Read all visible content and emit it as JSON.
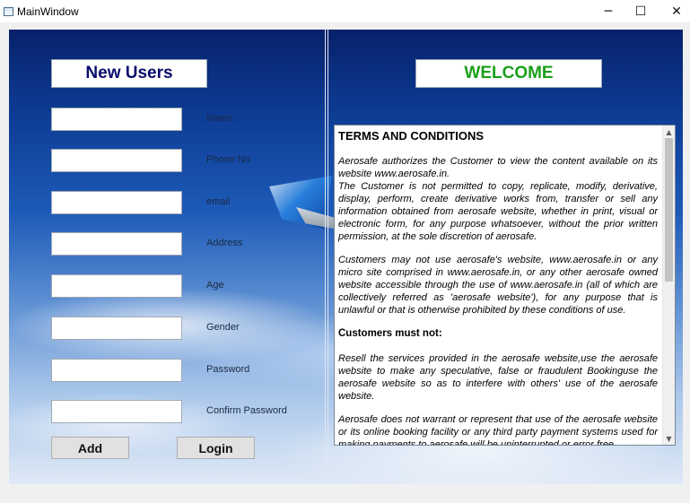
{
  "window": {
    "title": "MainWindow",
    "minimize_glyph": "─",
    "maximize_glyph": "☐",
    "close_glyph": "✕"
  },
  "left_panel": {
    "heading": "New Users",
    "fields": [
      {
        "label": "Name",
        "value": ""
      },
      {
        "label": "Phone No",
        "value": ""
      },
      {
        "label": "email",
        "value": ""
      },
      {
        "label": "Address",
        "value": ""
      },
      {
        "label": "Age",
        "value": ""
      },
      {
        "label": "Gender",
        "value": ""
      },
      {
        "label": "Password",
        "value": ""
      },
      {
        "label": "Confirm Password",
        "value": ""
      }
    ],
    "add_label": "Add",
    "login_label": "Login"
  },
  "right_panel": {
    "heading": "WELCOME",
    "terms": {
      "title": "TERMS AND CONDITIONS",
      "paragraphs": [
        "Aerosafe authorizes the Customer to view the content available on its website www.aerosafe.in.",
        "The Customer is not permitted to copy, replicate, modify, derivative, display, perform, create derivative works from, transfer or sell any information obtained from aerosafe website, whether in print, visual or electronic form, for any purpose whatsoever, without the prior written permission, at the sole discretion of aerosafe.",
        "Customers may not use aerosafe's website, www.aerosafe.in or any micro site comprised in www.aerosafe.in, or any other aerosafe owned website accessible through the use of www.aerosafe.in (all of which are collectively referred as 'aerosafe website'), for any purpose that is unlawful or that is otherwise prohibited by these conditions of use.",
        "Customers must not:",
        "Resell the services provided in the aerosafe website,use the aerosafe website to make any speculative, false or fraudulent Bookinguse the aerosafe website so as to interfere with others' use of the aerosafe website.",
        "Aerosafe does not warrant or represent that use of the aerosafe website or its online booking facility or any third party payment systems used for making payments to aerosafe will be uninterrupted or error free."
      ]
    },
    "scroll_up_glyph": "▲",
    "scroll_down_glyph": "▼"
  },
  "colors": {
    "new_users_heading": "#0a0a6e",
    "welcome_heading": "#1aa01a"
  }
}
